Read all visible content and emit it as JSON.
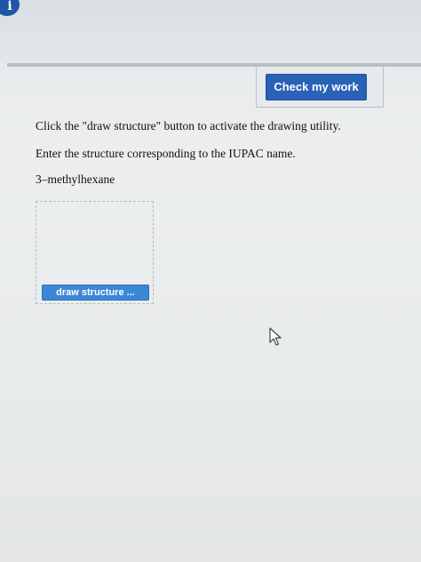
{
  "header": {
    "info_icon_glyph": "i",
    "check_button_label": "Check my work"
  },
  "question": {
    "instruction_1": "Click the \"draw structure\" button to activate the drawing utility.",
    "instruction_2": "Enter the structure corresponding to the IUPAC name.",
    "compound_name": "3–methylhexane"
  },
  "drawing": {
    "draw_button_label": "draw structure ..."
  },
  "icons": {
    "info": "info-icon",
    "cursor": "mouse-pointer-icon"
  },
  "colors": {
    "primary_button": "#2a62b8",
    "draw_button": "#3b87d6",
    "info_icon": "#1f56a8"
  }
}
